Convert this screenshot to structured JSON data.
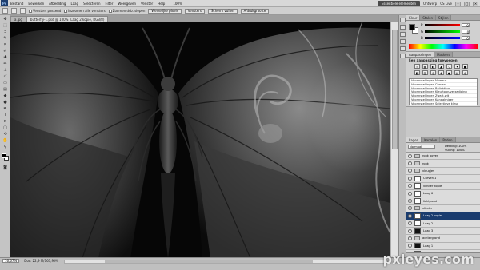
{
  "menubar": {
    "logo": "Ps",
    "items": [
      "Bestand",
      "Bewerken",
      "Afbeelding",
      "Laag",
      "Selecteren",
      "Filter",
      "Weergeven",
      "Venster",
      "Help"
    ],
    "zoom": "100%",
    "workspace": "Essentiële elementen",
    "workspace_alt": "Ontwerp",
    "cs_live": "CS Live"
  },
  "options": {
    "checks": [
      "Vensters passend",
      "Inzoomen alle vensters",
      "Zoomen dsb. slepen"
    ],
    "buttons": [
      "Werkelijke pixels",
      "Vensters",
      "Scherm vullen",
      "Afdrukgrootte"
    ]
  },
  "doc_tabs": [
    "a.jpg",
    "butterfly-1.psd @ 100% (Laag 2 kopie, RGB/8)"
  ],
  "color_panel": {
    "tabs": [
      "Kleur",
      "Stalen",
      "Stijlen"
    ],
    "sliders": [
      {
        "label": "R",
        "value": "0",
        "gradient": "linear-gradient(to right,#000,#f00)"
      },
      {
        "label": "G",
        "value": "0",
        "gradient": "linear-gradient(to right,#000,#0f0)"
      },
      {
        "label": "B",
        "value": "0",
        "gradient": "linear-gradient(to right,#000,#00f)"
      }
    ]
  },
  "adjust_panel": {
    "tabs": [
      "Aanpassingen",
      "Maskers"
    ],
    "title": "Een aanpassing toevoegen",
    "icons": [
      "☼",
      "▦",
      "◐",
      "▲",
      "▽",
      "✦",
      "■",
      "◧",
      "▥",
      "◑",
      "◈",
      "◒",
      "▤",
      "◍"
    ],
    "presets": [
      "Voorinstellingen Niveaus",
      "Voorinstellingen Curven",
      "Voorinstellingen Belichting",
      "Voorinstellingen Kleurtoon/verzadiging",
      "Voorinstellingen Zwart-wit",
      "Voorinstellingen Kanaalmixer",
      "Voorinstellingen Selectieve kleur"
    ]
  },
  "layers_panel": {
    "tabs": [
      "Lagen",
      "Kanalen",
      "Paden"
    ],
    "blend_mode": "Normaal",
    "opacity": "Dekking: 100%",
    "fill": "Vulling: 100%",
    "rows": [
      {
        "name": "rook boven",
        "kind": "folder",
        "state": ""
      },
      {
        "name": "rook",
        "kind": "folder",
        "state": ""
      },
      {
        "name": "vleugjes",
        "kind": "folder",
        "state": ""
      },
      {
        "name": "Curven 1",
        "kind": "light",
        "state": ""
      },
      {
        "name": "vlinder kopie",
        "kind": "light",
        "state": ""
      },
      {
        "name": "Laag 6",
        "kind": "light",
        "state": ""
      },
      {
        "name": "licht/rood",
        "kind": "light",
        "state": ""
      },
      {
        "name": "vlinder",
        "kind": "folder",
        "state": ""
      },
      {
        "name": "Laag 2 kopie",
        "kind": "light",
        "state": "selected"
      },
      {
        "name": "Laag 2",
        "kind": "light",
        "state": ""
      },
      {
        "name": "Laag 3",
        "kind": "dark",
        "state": ""
      },
      {
        "name": "achtergrond",
        "kind": "folder",
        "state": ""
      },
      {
        "name": "Laag 1",
        "kind": "dark",
        "state": ""
      },
      {
        "name": "Laag 5",
        "kind": "light",
        "state": ""
      }
    ]
  },
  "status": {
    "zoom": "16,67%",
    "doc": "Doc: 22,9 M/163,9 M"
  },
  "watermark": "pxleyes.com"
}
